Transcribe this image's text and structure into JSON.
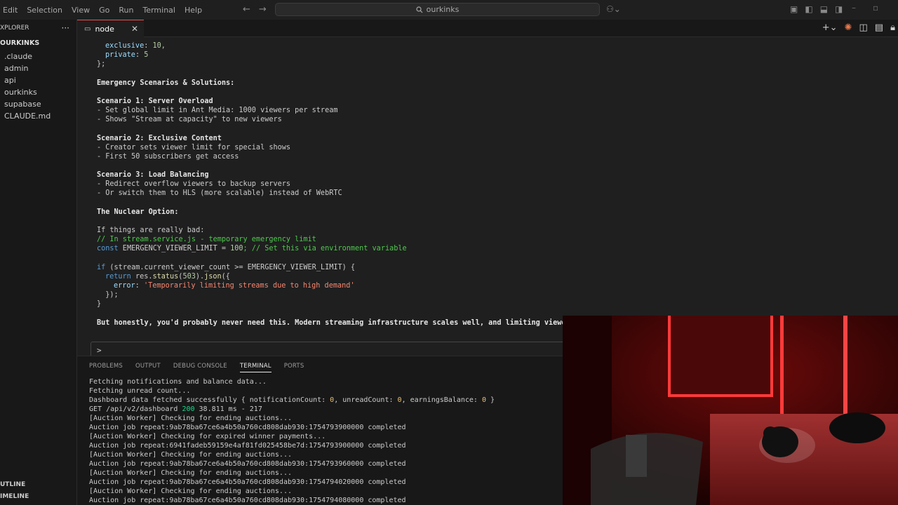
{
  "menu": [
    "Edit",
    "Selection",
    "View",
    "Go",
    "Run",
    "Terminal",
    "Help"
  ],
  "search": {
    "text": "ourkinks"
  },
  "sidebar": {
    "header": "XPLORER",
    "root": "OURKINKS",
    "items": [
      ".claude",
      "admin",
      "api",
      "ourkinks",
      "supabase",
      "CLAUDE.md"
    ],
    "outline": "UTLINE",
    "timeline": "IMELINE"
  },
  "tab": {
    "label": "node"
  },
  "editor": {
    "prop1": "exclusive",
    "num1": "10,",
    "prop2": "private",
    "num2": "5",
    "close": "};",
    "h_emergency": "Emergency Scenarios & Solutions:",
    "s1_title": "Scenario 1: Server Overload",
    "s1_a": "- Set global limit in Ant Media: 1000 viewers per stream",
    "s1_b": "- Shows \"Stream at capacity\" to new viewers",
    "s2_title": "Scenario 2: Exclusive Content",
    "s2_a": "- Creator sets viewer limit for special shows",
    "s2_b": "- First 50 subscribers get access",
    "s3_title": "Scenario 3: Load Balancing",
    "s3_a": "- Redirect overflow viewers to backup servers",
    "s3_b": "- Or switch them to HLS (more scalable) instead of WebRTC",
    "nuclear": "The Nuclear Option:",
    "bad": "If things are really bad:",
    "comment1": "// In stream.service.js - temporary emergency limit",
    "const_kw": "const",
    "const_name": " EMERGENCY_VIEWER_LIMIT = ",
    "const_val": "100",
    "const_cmt": "; // Set this via environment variable",
    "if_kw": "if",
    "if_rest": " (stream.current_viewer_count >= EMERGENCY_VIEWER_LIMIT) {",
    "ret_kw": "return",
    "ret_a": " res.",
    "ret_fn": "status",
    "ret_b": "(",
    "ret_num": "503",
    "ret_c": ").",
    "ret_fn2": "json",
    "ret_d": "({",
    "err_key": "error",
    "err_colon": ": ",
    "err_str": "'Temporarily limiting streams due to high demand'",
    "close_obj": "  });",
    "close_if": "}",
    "honestly": "But honestly, you'd probably never need this. Modern streaming infrastructure scales well, and limiting viewers hur",
    "prompt": ">"
  },
  "panel": {
    "tabs": [
      "PROBLEMS",
      "OUTPUT",
      "DEBUG CONSOLE",
      "TERMINAL",
      "PORTS"
    ],
    "active_tab": "TERMINAL",
    "lines": [
      "Fetching notifications and balance data...",
      "Fetching unread count...",
      "Dashboard data fetched successfully { notificationCount: 0, unreadCount: 0, earningsBalance: 0 }",
      "GET /api/v2/dashboard 200 38.811 ms - 217",
      "[Auction Worker] Checking for ending auctions...",
      "Auction job repeat:9ab78ba67ce6a4b50a760cd808dab930:1754793900000 completed",
      "[Auction Worker] Checking for expired winner payments...",
      "Auction job repeat:6941fadeb59159e4af81fd025458be7d:1754793900000 completed",
      "[Auction Worker] Checking for ending auctions...",
      "Auction job repeat:9ab78ba67ce6a4b50a760cd808dab930:1754793960000 completed",
      "[Auction Worker] Checking for ending auctions...",
      "Auction job repeat:9ab78ba67ce6a4b50a760cd808dab930:1754794020000 completed",
      "[Auction Worker] Checking for ending auctions...",
      "Auction job repeat:9ab78ba67ce6a4b50a760cd808dab930:1754794080000 completed"
    ],
    "dash_prefix": "Dashboard data fetched successfully { notificationCount: ",
    "dash_n1": "0",
    "dash_mid1": ", unreadCount: ",
    "dash_n2": "0",
    "dash_mid2": ", earningsBalance: ",
    "dash_n3": "0",
    "dash_suffix": " }",
    "get_prefix": "GET /api/v2/dashboard ",
    "get_status": "200",
    "get_suffix": " 38.811 ms - 217"
  },
  "colors": {
    "accent_red": "#f14c4c",
    "string_red": "#f48771",
    "comment_green": "#4ec94e",
    "number_green": "#b5cea8"
  }
}
